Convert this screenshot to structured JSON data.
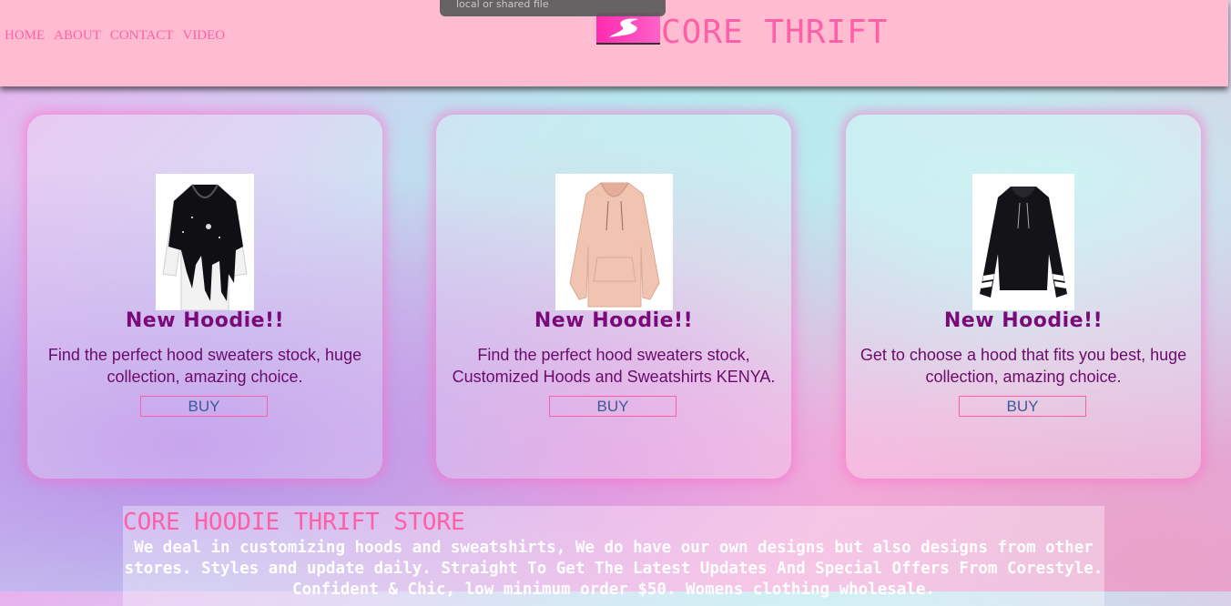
{
  "tooltip": {
    "text": "local or shared file"
  },
  "nav": {
    "items": [
      {
        "label": "HOME"
      },
      {
        "label": "ABOUT"
      },
      {
        "label": "CONTACT"
      },
      {
        "label": "VIDEO"
      }
    ]
  },
  "brand": {
    "title": "CORE THRIFT"
  },
  "cards": [
    {
      "title": "New Hoodie!!",
      "description": "Find the perfect hood sweaters stock, huge collection, amazing choice.",
      "buy_label": "BUY"
    },
    {
      "title": "New Hoodie!!",
      "description": "Find the perfect hood sweaters stock, Customized Hoods and Sweatshirts KENYA.",
      "buy_label": "BUY"
    },
    {
      "title": "New Hoodie!!",
      "description": "Get to choose a hood that fits you best, huge collection, amazing choice.",
      "buy_label": "BUY"
    }
  ],
  "about": {
    "title": "CORE HOODIE THRIFT STORE",
    "text": "We deal in customizing hoods and sweatshirts, We do have our own designs but also designs from other stores. Styles and update daily. Straight To Get The Latest Updates And Special Offers From Corestyle. Confident & Chic, low minimum order $50. Womens clothing wholesale."
  },
  "colors": {
    "header_bg": "#ffbcd0",
    "accent_pink": "#ff5fa8",
    "title_purple": "#7a0a7a",
    "buy_text": "#3c5a9a"
  }
}
